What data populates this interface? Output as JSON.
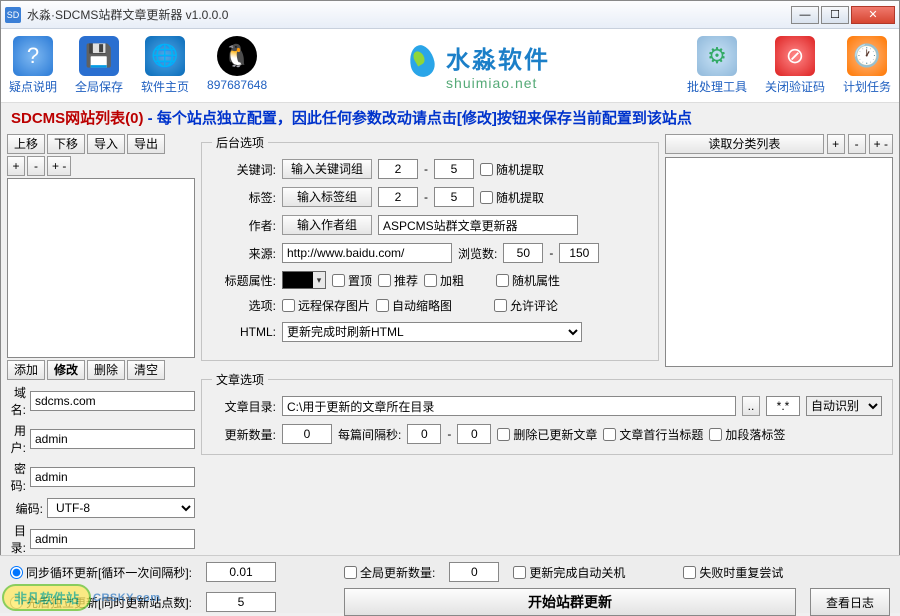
{
  "window": {
    "title": "水淼·SDCMS站群文章更新器 v1.0.0.0"
  },
  "toolbar": {
    "help": "疑点说明",
    "save": "全局保存",
    "home": "软件主页",
    "qq": "897687648",
    "batch": "批处理工具",
    "captcha": "关闭验证码",
    "schedule": "计划任务"
  },
  "brand": {
    "cn": "水淼软件",
    "en": "shuimiao.net"
  },
  "header": {
    "title": "SDCMS网站列表(0)",
    "hint": " - 每个站点独立配置，因此任何参数改动请点击[修改]按钮来保存当前配置到该站点"
  },
  "left": {
    "up": "上移",
    "down": "下移",
    "import": "导入",
    "export": "导出",
    "b_plus": "+",
    "b_minus": "-",
    "b_pm": "+ -",
    "add": "添加",
    "edit": "修改",
    "del": "删除",
    "clear": "清空",
    "lbl_domain": "域名:",
    "domain": "sdcms.com",
    "lbl_user": "用户:",
    "user": "admin",
    "lbl_pass": "密码:",
    "pass": "admin",
    "lbl_enc": "编码:",
    "enc": "UTF-8",
    "lbl_dir": "目录:",
    "dir": "admin"
  },
  "mid": {
    "legend1": "后台选项",
    "lbl_kw": "关键词:",
    "kw_btn": "输入关键词组",
    "kw_a": "2",
    "kw_b": "5",
    "kw_rand": "随机提取",
    "lbl_tag": "标签:",
    "tag_btn": "输入标签组",
    "tag_a": "2",
    "tag_b": "5",
    "tag_rand": "随机提取",
    "lbl_author": "作者:",
    "author_btn": "输入作者组",
    "author_val": "ASPCMS站群文章更新器",
    "lbl_src": "来源:",
    "src": "http://www.baidu.com/",
    "lbl_views": "浏览数:",
    "va": "50",
    "vb": "150",
    "lbl_titleattr": "标题属性:",
    "c_top": "置顶",
    "c_rec": "推荐",
    "c_bold": "加粗",
    "c_randattr": "随机属性",
    "lbl_opt": "选项:",
    "c_saveimg": "远程保存图片",
    "c_thumb": "自动缩略图",
    "c_comment": "允许评论",
    "lbl_html": "HTML:",
    "html_sel": "更新完成时刷新HTML",
    "legend2": "文章选项",
    "lbl_artdir": "文章目录:",
    "artdir": "C:\\用于更新的文章所在目录",
    "dots": "..",
    "ext": "*.*",
    "auto": "自动识别",
    "lbl_upcnt": "更新数量:",
    "upcnt": "0",
    "lbl_interval": "每篇间隔秒:",
    "ia": "0",
    "ib": "0",
    "c_delupd": "删除已更新文章",
    "c_firstline": "文章首行当标题",
    "c_addpara": "加段落标签"
  },
  "right": {
    "readcat": "读取分类列表",
    "b_plus": "+",
    "b_minus": "-",
    "b_pm": "+ -"
  },
  "bottom": {
    "r1": "同步循环更新[循环一次间隔秒]:",
    "v1": "0.01",
    "r2": "先后独立更新[同时更新站点数]:",
    "v2": "5",
    "c_global": "全局更新数量:",
    "gv": "0",
    "c_shutdown": "更新完成自动关机",
    "c_retry": "失败时重复尝试",
    "start": "开始站群更新",
    "log": "查看日志"
  },
  "watermark": {
    "t1": "非凡软件站",
    "t2": "CRSKY.com"
  }
}
